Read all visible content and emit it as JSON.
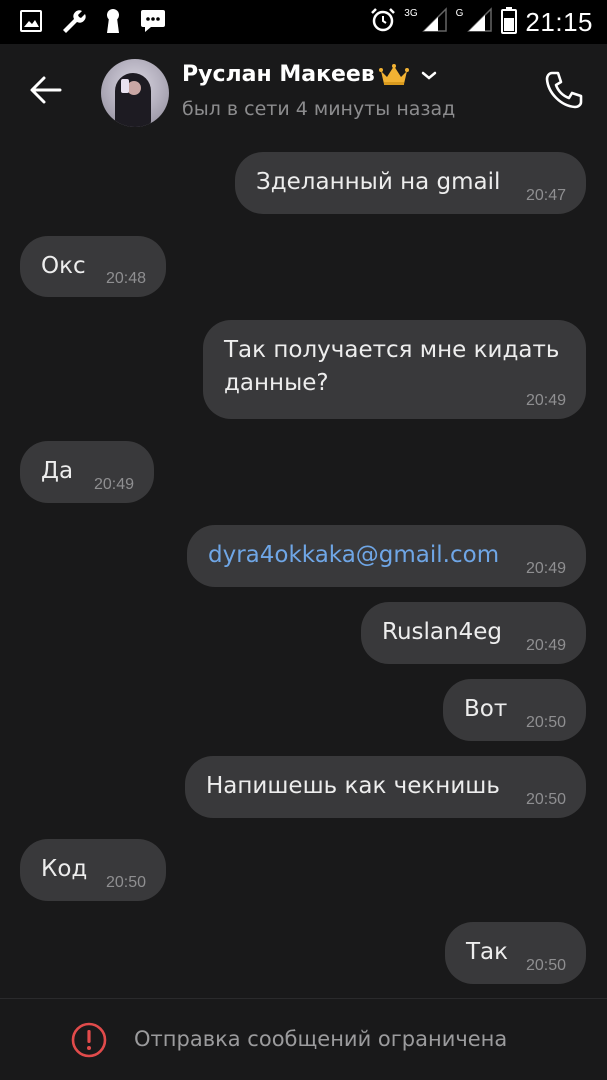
{
  "status_bar": {
    "time": "21:15",
    "network_1": "3G",
    "network_2": "G",
    "icons": [
      "image-icon",
      "wrench-icon",
      "keyhole-icon",
      "sms-icon",
      "alarm-icon",
      "signal-icon",
      "signal-icon",
      "battery-icon"
    ]
  },
  "header": {
    "contact_name": "Руслан Макеев",
    "status": "был в сети 4 минуты назад",
    "icons": [
      "back-arrow-icon",
      "crown-icon",
      "chevron-down-icon",
      "phone-icon"
    ]
  },
  "messages": [
    {
      "side": "out",
      "text": "Зделанный на gmail",
      "time": "20:47"
    },
    {
      "side": "in",
      "text": "Окс",
      "time": "20:48"
    },
    {
      "side": "out",
      "text": "Так получается мне кидать\nданные?",
      "time": "20:49"
    },
    {
      "side": "in",
      "text": "Да",
      "time": "20:49"
    },
    {
      "side": "out",
      "text": "dyra4okkaka@gmail.com",
      "time": "20:49",
      "is_link": true
    },
    {
      "side": "out",
      "text": "Ruslan4eg",
      "time": "20:49"
    },
    {
      "side": "out",
      "text": "Вот",
      "time": "20:50"
    },
    {
      "side": "out",
      "text": "Напишешь как чекнишь",
      "time": "20:50"
    },
    {
      "side": "in",
      "text": "Код",
      "time": "20:50"
    },
    {
      "side": "out",
      "text": "Так",
      "time": "20:50"
    }
  ],
  "footer": {
    "notice": "Отправка сообщений ограничена",
    "icon": "warning-circle-icon"
  },
  "colors": {
    "background": "#19191a",
    "bubble": "#39393b",
    "link": "#6fa6e6",
    "warning": "#e14b4b",
    "crown": "#f2b233"
  }
}
